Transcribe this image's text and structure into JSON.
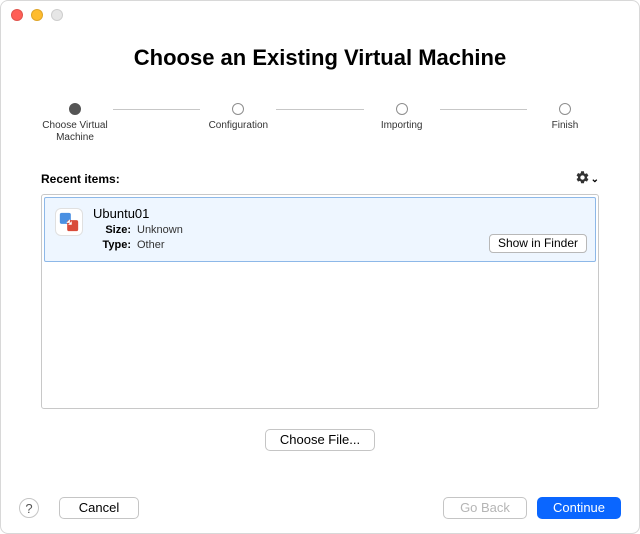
{
  "title": "Choose an Existing Virtual Machine",
  "stepper": {
    "steps": [
      {
        "label": "Choose Virtual\nMachine",
        "active": true
      },
      {
        "label": "Configuration",
        "active": false
      },
      {
        "label": "Importing",
        "active": false
      },
      {
        "label": "Finish",
        "active": false
      }
    ]
  },
  "recent": {
    "heading": "Recent items:",
    "items": [
      {
        "name": "Ubuntu01",
        "size_label": "Size:",
        "size_value": "Unknown",
        "type_label": "Type:",
        "type_value": "Other",
        "show_in_finder": "Show in Finder",
        "selected": true
      }
    ]
  },
  "buttons": {
    "choose_file": "Choose File...",
    "help": "?",
    "cancel": "Cancel",
    "go_back": "Go Back",
    "continue": "Continue"
  },
  "colors": {
    "primary": "#0a66ff",
    "selection_bg": "#eef6ff",
    "selection_border": "#8db8e8"
  }
}
